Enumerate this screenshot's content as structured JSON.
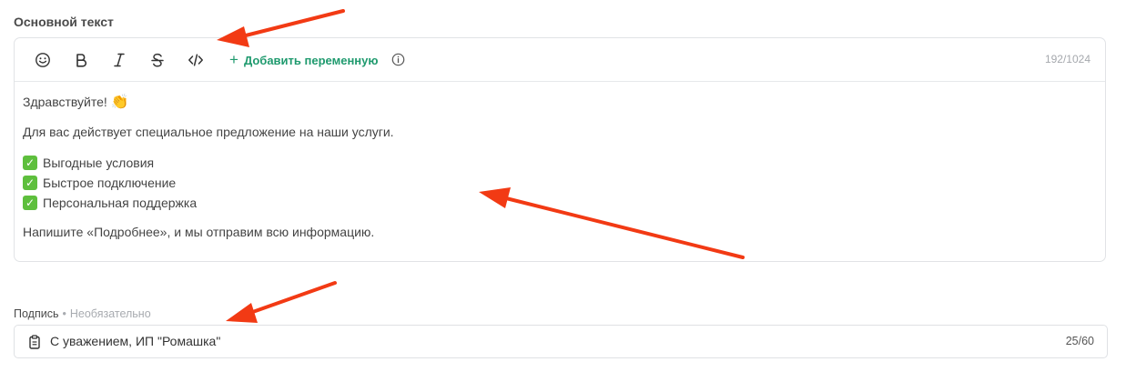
{
  "main_text": {
    "label": "Основной текст",
    "toolbar": {
      "emoji_icon": "emoji-icon",
      "bold_icon": "B",
      "italic_icon": "I",
      "strike_icon": "S",
      "code_icon": "code-icon",
      "add_variable_label": "Добавить переменную",
      "info_icon": "info-icon"
    },
    "counter": "192/1024",
    "content": {
      "greeting": "Здравствуйте!",
      "greeting_emoji": "👏",
      "offer": "Для вас действует специальное предложение на наши услуги.",
      "checklist": [
        "Выгодные условия",
        "Быстрое подключение",
        "Персональная поддержка"
      ],
      "cta": "Напишите «Подробнее», и мы отправим всю информацию."
    }
  },
  "signature": {
    "label": "Подпись",
    "separator": "•",
    "optional_label": "Необязательно",
    "value": "С уважением, ИП \"Ромашка\"",
    "counter": "25/60"
  },
  "colors": {
    "accent_green": "#1f9a6e",
    "arrow_red": "#f23a14",
    "checkbox_green": "#5ebf3d"
  }
}
